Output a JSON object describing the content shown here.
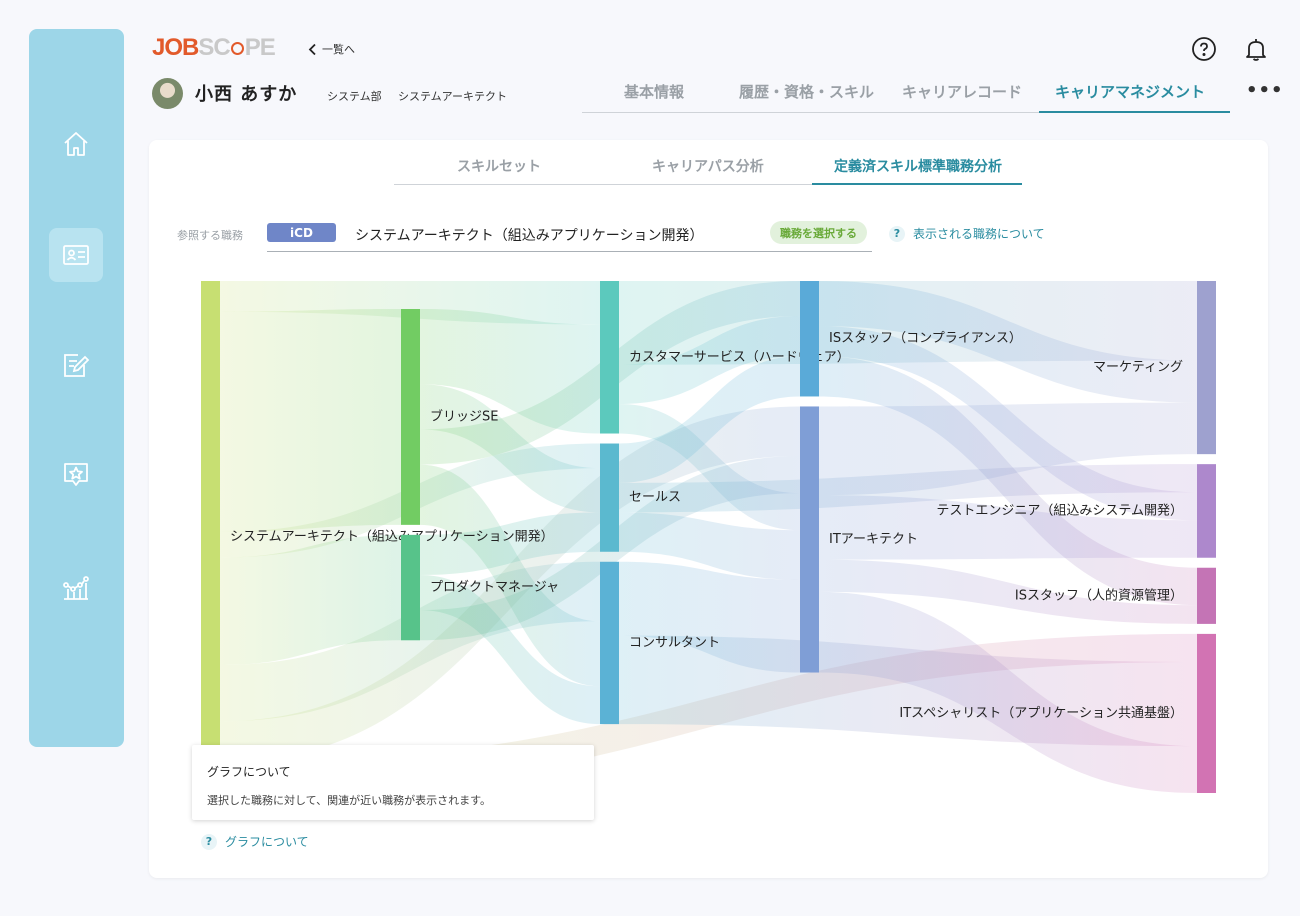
{
  "brand": {
    "part1": "JOB",
    "part2_a": "SC",
    "part2_b": "PE"
  },
  "header": {
    "back_label": "一覧へ",
    "help_icon": "question-circle-icon",
    "bell_icon": "bell-icon",
    "user_name": "小西 あすか",
    "department": "システム部",
    "role": "システムアーキテクト",
    "tabs": [
      "基本情報",
      "履歴・資格・スキル",
      "キャリアレコード",
      "キャリアマネジメント"
    ],
    "active_tab": "キャリアマネジメント",
    "more": "•••"
  },
  "sidebar": {
    "items": [
      {
        "icon": "home-icon"
      },
      {
        "icon": "profile-card-icon",
        "active": true
      },
      {
        "icon": "edit-document-icon"
      },
      {
        "icon": "star-badge-icon"
      },
      {
        "icon": "analytics-icon"
      }
    ]
  },
  "subtabs": [
    "スキルセット",
    "キャリアパス分析",
    "定義済スキル標準職務分析"
  ],
  "active_subtab": "定義済スキル標準職務分析",
  "reference": {
    "label": "参照する職務",
    "badge": "iCD",
    "value": "システムアーキテクト（組込みアプリケーション開発）",
    "select_button": "職務を選択する",
    "help_link": "表示される職務について"
  },
  "tooltip": {
    "title": "グラフについて",
    "body": "選択した職務に対して、関連が近い職務が表示されます。"
  },
  "graph_help_link": "グラフについて",
  "colors": {
    "accent": "#2a8ca0",
    "sidebar": "#9dd6e8",
    "brand_orange": "#e25a2b",
    "icd_badge": "#6f86c8"
  },
  "sankey": {
    "nodes": [
      {
        "id": "sa",
        "label": "システムアーキテクト（組込みアプリケーション開発）",
        "column": 0,
        "color": "#c7df72",
        "size": 100
      },
      {
        "id": "bse",
        "label": "ブリッジSE",
        "column": 1,
        "color": "#72cc63",
        "size": 43
      },
      {
        "id": "pm",
        "label": "プロダクトマネージャ",
        "column": 1,
        "color": "#57c38a",
        "size": 21
      },
      {
        "id": "cs",
        "label": "カスタマーサービス（ハードウェア）",
        "column": 2,
        "color": "#5cc9bd",
        "size": 31
      },
      {
        "id": "sales",
        "label": "セールス",
        "column": 2,
        "color": "#5bb9cf",
        "size": 22
      },
      {
        "id": "cons",
        "label": "コンサルタント",
        "column": 2,
        "color": "#5bb2d5",
        "size": 33
      },
      {
        "id": "iss",
        "label": "ISスタッフ（コンプライアンス）",
        "column": 3,
        "color": "#5aaad8",
        "size": 23
      },
      {
        "id": "ita",
        "label": "ITアーキテクト",
        "column": 3,
        "color": "#7f9ed6",
        "size": 53
      },
      {
        "id": "mkt",
        "label": "マーケティング",
        "column": 4,
        "color": "#9ea1cf",
        "size": 37
      },
      {
        "id": "te",
        "label": "テストエンジニア（組込みシステム開発）",
        "column": 4,
        "color": "#ad88cc",
        "size": 20
      },
      {
        "id": "ishr",
        "label": "ISスタッフ（人的資源管理）",
        "column": 4,
        "color": "#c474b5",
        "size": 12
      },
      {
        "id": "itsp",
        "label": "ITスペシャリスト（アプリケーション共通基盤）",
        "column": 4,
        "color": "#d273b3",
        "size": 34
      }
    ],
    "links": [
      {
        "source": "sa",
        "target": "cs",
        "value": 6
      },
      {
        "source": "sa",
        "target": "bse",
        "value": 43
      },
      {
        "source": "sa",
        "target": "sales",
        "value": 5
      },
      {
        "source": "sa",
        "target": "pm",
        "value": 21
      },
      {
        "source": "sa",
        "target": "cons",
        "value": 11
      },
      {
        "source": "sa",
        "target": "ita",
        "value": 8
      },
      {
        "source": "sa",
        "target": "itsp",
        "value": 6
      },
      {
        "source": "bse",
        "target": "cs",
        "value": 15
      },
      {
        "source": "bse",
        "target": "sales",
        "value": 9
      },
      {
        "source": "bse",
        "target": "iss",
        "value": 7
      },
      {
        "source": "bse",
        "target": "cons",
        "value": 12
      },
      {
        "source": "pm",
        "target": "sales",
        "value": 8
      },
      {
        "source": "pm",
        "target": "cons",
        "value": 7
      },
      {
        "source": "pm",
        "target": "ita",
        "value": 6
      },
      {
        "source": "cs",
        "target": "mkt",
        "value": 17
      },
      {
        "source": "cs",
        "target": "iss",
        "value": 8
      },
      {
        "source": "cs",
        "target": "ita",
        "value": 6
      },
      {
        "source": "sales",
        "target": "iss",
        "value": 8
      },
      {
        "source": "sales",
        "target": "te",
        "value": 6
      },
      {
        "source": "sales",
        "target": "ita",
        "value": 8
      },
      {
        "source": "cons",
        "target": "ita",
        "value": 15
      },
      {
        "source": "cons",
        "target": "itsp",
        "value": 18
      },
      {
        "source": "iss",
        "target": "mkt",
        "value": 9
      },
      {
        "source": "iss",
        "target": "te",
        "value": 6
      },
      {
        "source": "iss",
        "target": "ishr",
        "value": 8
      },
      {
        "source": "ita",
        "target": "mkt",
        "value": 11
      },
      {
        "source": "ita",
        "target": "te",
        "value": 8
      },
      {
        "source": "ita",
        "target": "ishr",
        "value": 4
      },
      {
        "source": "ita",
        "target": "itsp",
        "value": 10
      }
    ]
  }
}
